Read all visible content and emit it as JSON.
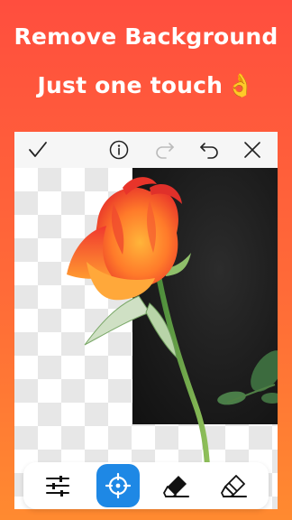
{
  "headline": {
    "line1": "Remove Background",
    "line2": "Just one touch",
    "line2_emoji": "👌"
  },
  "toolbar": {
    "icons": [
      "check-icon",
      "info-icon",
      "redo-icon",
      "undo-icon",
      "close-icon"
    ],
    "redo_enabled": false
  },
  "bottom_tools": {
    "icons": [
      "adjust-sliders-icon",
      "target-icon",
      "eraser-filled-icon",
      "eraser-outline-icon"
    ],
    "active_tool": "target-icon",
    "active_color": "#1E88E5"
  },
  "colors": {
    "background_top": "#FF4E3E",
    "background_bottom": "#FF8A30"
  }
}
